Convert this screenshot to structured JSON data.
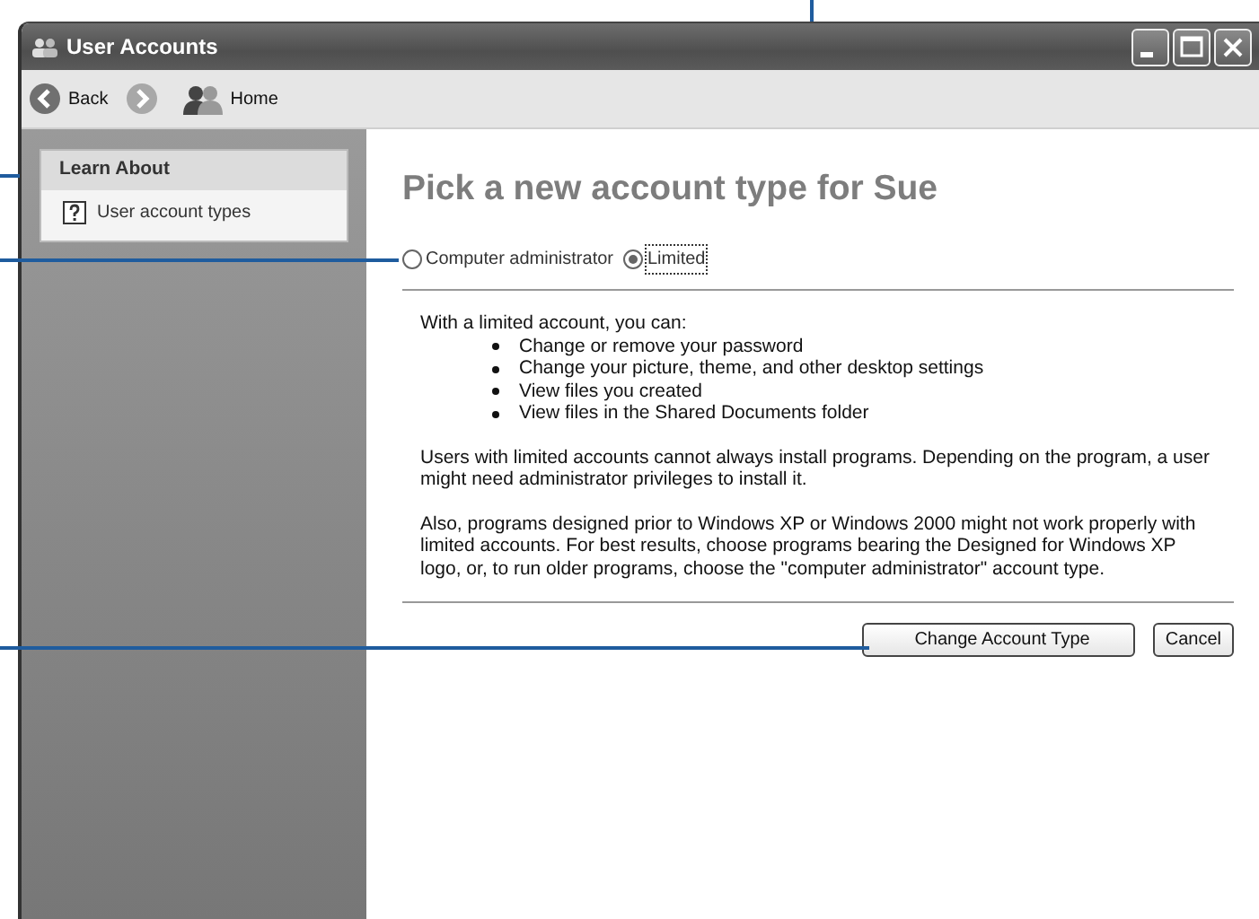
{
  "window": {
    "title": "User Accounts"
  },
  "toolbar": [
    {
      "kind": "back",
      "label": "Back"
    },
    {
      "kind": "forward"
    },
    {
      "kind": "home",
      "label": "Home"
    }
  ],
  "sidebar": {
    "heading": "Learn About",
    "items": [
      {
        "label": "User account types"
      }
    ]
  },
  "content": {
    "heading": "Pick a new account type for Sue",
    "radios": [
      {
        "label": "Computer administrator",
        "selected": false
      },
      {
        "label": "Limited",
        "selected": true
      }
    ],
    "intro": "With a limited account, you can:",
    "bullets": [
      "Change or remove your password",
      "Change your picture, theme, and other desktop settings",
      "View files you created",
      "View files in the Shared Documents folder"
    ],
    "paragraphs": [
      "Users with limited accounts cannot always install programs. Depending on the program, a user might need administrator privileges to install it.",
      "Also, programs designed prior to Windows XP or Windows 2000 might not work properly with limited accounts. For best results, choose programs bearing the Designed for Windows XP logo, or, to run older programs, choose the \"computer administrator\" account type."
    ],
    "buttons": [
      {
        "label": "Change Account Type",
        "kind": "primary"
      },
      {
        "label": "Cancel",
        "kind": "normal"
      }
    ]
  }
}
